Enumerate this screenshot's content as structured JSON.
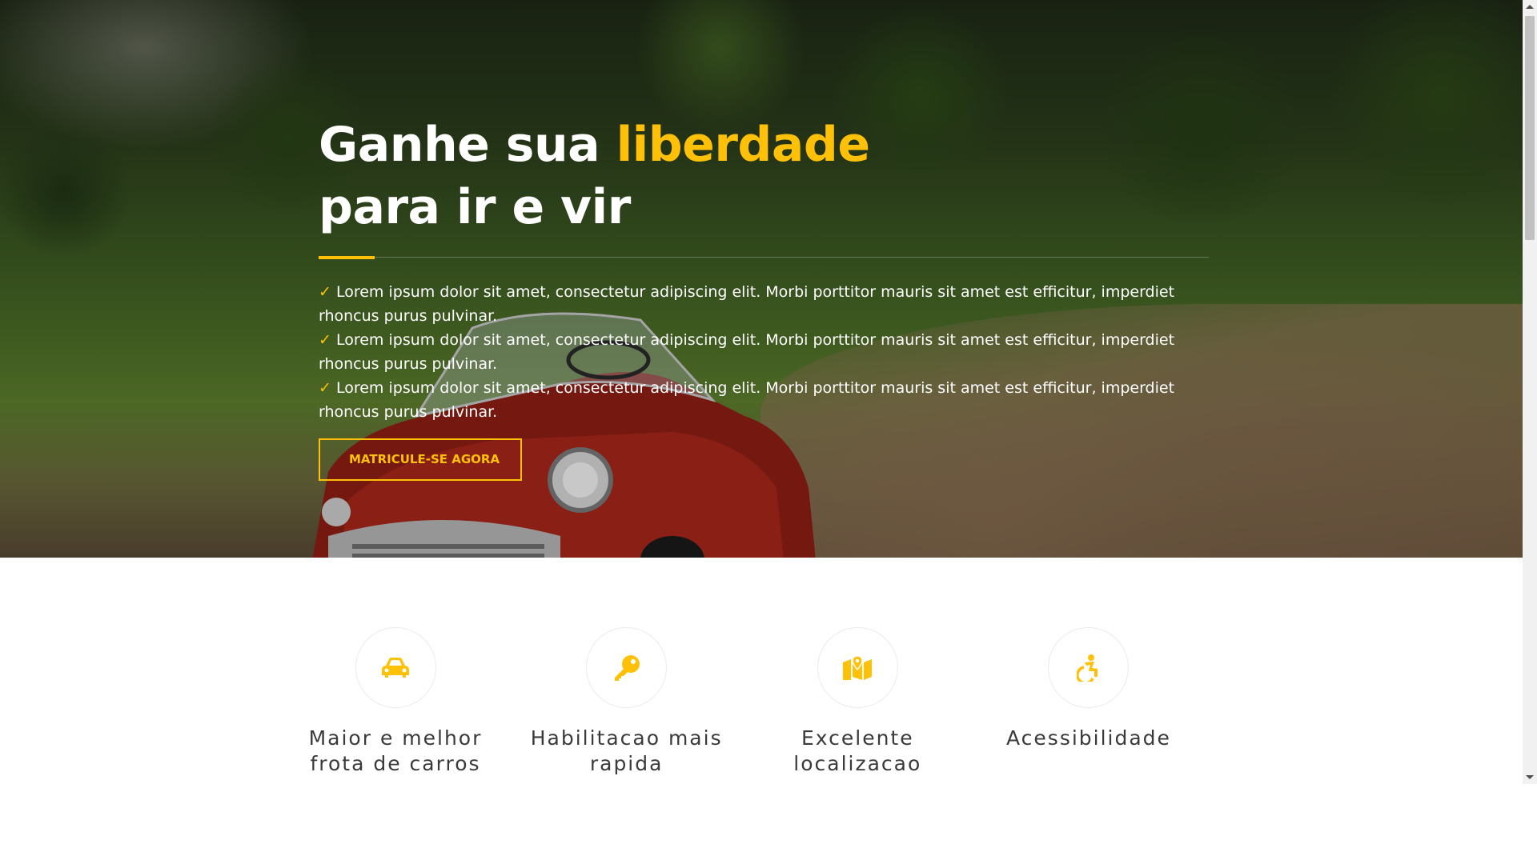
{
  "hero": {
    "headline_part1": "Ganhe sua ",
    "headline_accent": "liberdade",
    "headline_line2": "para ir e vir",
    "bullets": [
      "Lorem ipsum dolor sit amet, consectetur adipiscing elit. Morbi porttitor mauris sit amet est efficitur, imperdiet rhoncus purus pulvinar.",
      "Lorem ipsum dolor sit amet, consectetur adipiscing elit. Morbi porttitor mauris sit amet est efficitur, imperdiet rhoncus purus pulvinar.",
      "Lorem ipsum dolor sit amet, consectetur adipiscing elit. Morbi porttitor mauris sit amet est efficitur, imperdiet rhoncus purus pulvinar."
    ],
    "check_symbol": "✓",
    "cta_label": "MATRICULE-SE AGORA",
    "background_image": "red-vintage-convertible-car-on-dirt-road"
  },
  "features": [
    {
      "icon": "car-icon",
      "title_line1": "Maior e melhor",
      "title_line2": "frota de carros"
    },
    {
      "icon": "key-icon",
      "title_line1": "Habilitacao mais",
      "title_line2": "rapida"
    },
    {
      "icon": "map-marker-icon",
      "title_line1": "Excelente",
      "title_line2": "localizacao"
    },
    {
      "icon": "accessibility-icon",
      "title_line1": "Acessibilidade",
      "title_line2": ""
    }
  ],
  "colors": {
    "accent": "#ffc107",
    "text_dark": "#3a3a3a",
    "hero_text": "#ffffff"
  }
}
